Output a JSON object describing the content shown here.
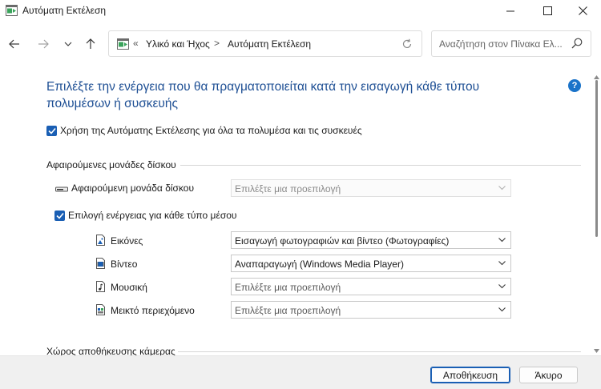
{
  "window": {
    "title": "Αυτόματη Εκτέλεση",
    "icon": "autoplay-icon"
  },
  "nav": {
    "breadcrumb_chevron": "«",
    "crumb_parent": "Υλικό και Ήχος",
    "crumb_separator": ">",
    "crumb_current": "Αυτόματη Εκτέλεση",
    "search_placeholder": "Αναζήτηση στον Πίνακα Ελ..."
  },
  "main": {
    "heading": "Επιλέξτε την ενέργεια που θα πραγματοποιείται κατά την εισαγωγή κάθε τύπου πολυμέσων ή συσκευής",
    "use_autoplay": {
      "label": "Χρήση της Αυτόματης Εκτέλεσης για όλα τα πολυμέσα και τις συσκευές",
      "checked": true
    },
    "removable_section": {
      "title": "Αφαιρούμενες μονάδες δίσκου",
      "drive_label": "Αφαιρούμενη μονάδα δίσκου",
      "drive_select": "Επιλέξτε μια προεπιλογή",
      "per_media": {
        "label": "Επιλογή ενέργειας για κάθε τύπο μέσου",
        "checked": true
      },
      "media": [
        {
          "label": "Εικόνες",
          "icon": "pictures-icon",
          "value": "Εισαγωγή φωτογραφιών και βίντεο (Φωτογραφίες)",
          "placeholder": false
        },
        {
          "label": "Βίντεο",
          "icon": "video-icon",
          "value": "Αναπαραγωγή (Windows Media Player)",
          "placeholder": false
        },
        {
          "label": "Μουσική",
          "icon": "music-icon",
          "value": "Επιλέξτε μια προεπιλογή",
          "placeholder": true
        },
        {
          "label": "Μεικτό περιεχόμενο",
          "icon": "mixed-content-icon",
          "value": "Επιλέξτε μια προεπιλογή",
          "placeholder": true
        }
      ]
    },
    "camera_section": {
      "title": "Χώρος αποθήκευσης κάμερας"
    }
  },
  "footer": {
    "save_label": "Αποθήκευση",
    "cancel_label": "Άκυρο"
  },
  "colors": {
    "heading": "#1e4f94",
    "accent": "#1a5fb4",
    "help": "#1a73c9"
  }
}
